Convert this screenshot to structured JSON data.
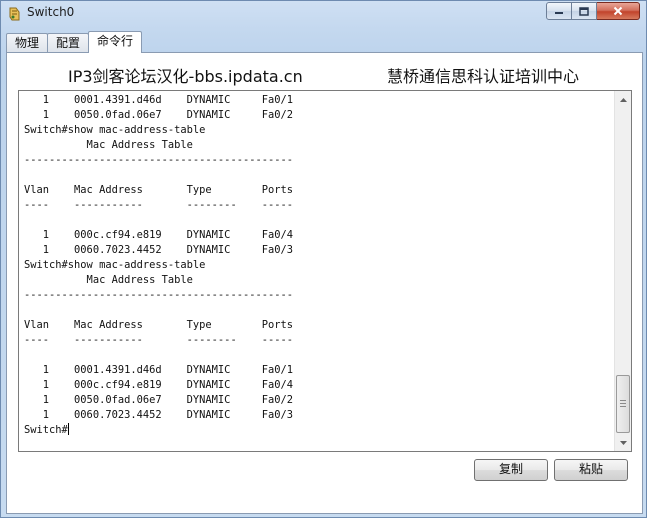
{
  "window": {
    "title": "Switch0",
    "icon": "switch-app-icon",
    "controls": {
      "minimize": "minimize-icon",
      "maximize": "maximize-icon",
      "close": "close-icon"
    }
  },
  "tabs": [
    {
      "label": "物理",
      "active": false
    },
    {
      "label": "配置",
      "active": false
    },
    {
      "label": "命令行",
      "active": true
    }
  ],
  "banner": {
    "left": "IP3剑客论坛汉化-bbs.ipdata.cn",
    "right": "慧桥通信思科认证培训中心"
  },
  "console": {
    "lines": [
      "   1    0001.4391.d46d    DYNAMIC     Fa0/1",
      "   1    0050.0fad.06e7    DYNAMIC     Fa0/2",
      "Switch#show mac-address-table",
      "          Mac Address Table",
      "-------------------------------------------",
      "",
      "Vlan    Mac Address       Type        Ports",
      "----    -----------       --------    -----",
      "",
      "   1    000c.cf94.e819    DYNAMIC     Fa0/4",
      "   1    0060.7023.4452    DYNAMIC     Fa0/3",
      "Switch#show mac-address-table",
      "          Mac Address Table",
      "-------------------------------------------",
      "",
      "Vlan    Mac Address       Type        Ports",
      "----    -----------       --------    -----",
      "",
      "   1    0001.4391.d46d    DYNAMIC     Fa0/1",
      "   1    000c.cf94.e819    DYNAMIC     Fa0/4",
      "   1    0050.0fad.06e7    DYNAMIC     Fa0/2",
      "   1    0060.7023.4452    DYNAMIC     Fa0/3"
    ],
    "prompt": "Switch#"
  },
  "buttons": {
    "copy": "复制",
    "paste": "粘贴"
  }
}
